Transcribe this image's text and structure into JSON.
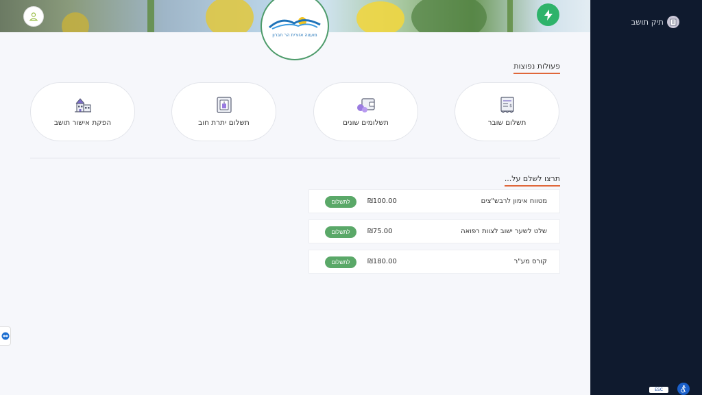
{
  "header": {
    "logo_text": "מועצה אזורית הר חברון"
  },
  "quick_actions": {
    "title": "פעולות נפוצות",
    "items": [
      {
        "label": "תשלום שובר",
        "icon": "voucher-icon"
      },
      {
        "label": "תשלומים שונים",
        "icon": "wallet-icon"
      },
      {
        "label": "תשלום יתרת חוב",
        "icon": "debt-icon"
      },
      {
        "label": "הפקת אישור תושב",
        "icon": "house-icon"
      }
    ]
  },
  "payments": {
    "title": "תרצו לשלם על...",
    "rows": [
      {
        "name": "מטווח אימון לרבש\"צים",
        "price": "₪100.00",
        "button": "לתשלום"
      },
      {
        "name": "שלט לשער ישוב לצוות רפואה",
        "price": "₪75.00",
        "button": "לתשלום"
      },
      {
        "name": "קורס מע\"ר",
        "price": "₪180.00",
        "button": "לתשלום"
      }
    ]
  },
  "sidebar": {
    "title": "תיק תושב"
  },
  "accessibility": {
    "esc_label": "ESC"
  },
  "colors": {
    "sidebar_bg": "#0f1a2e",
    "accent_underline": "#e0673a",
    "pay_button": "#5aa868",
    "bolt_button": "#2eb36a"
  }
}
